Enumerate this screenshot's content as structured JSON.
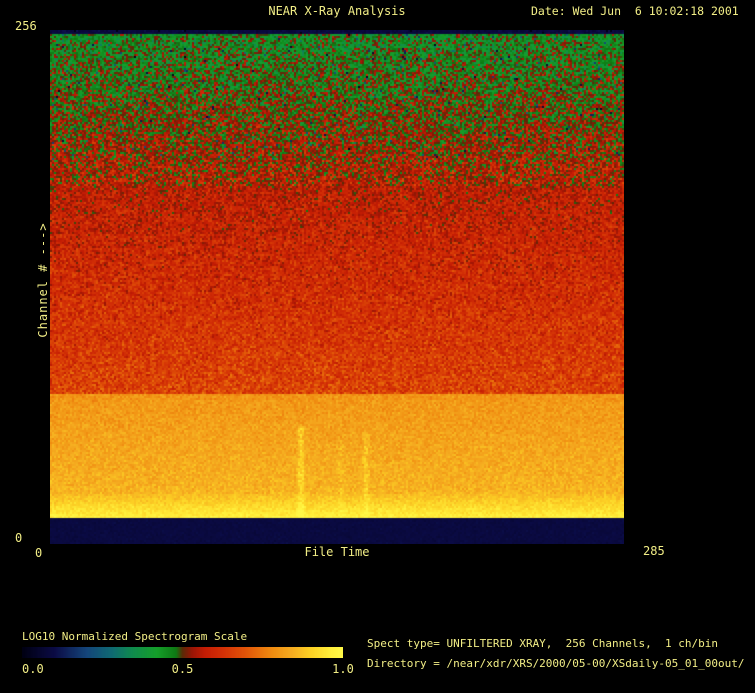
{
  "page": {
    "background": "#000000",
    "text_color": "#f2ee86"
  },
  "header": {
    "title": "NEAR X-Ray Analysis",
    "date": "Date: Wed Jun  6 10:02:18 2001"
  },
  "plot": {
    "y_max_label": "256",
    "y_min_label": "0",
    "y_axis_title": "Channel # --->",
    "x_min_label": "0",
    "x_max_label": "285",
    "x_axis_title": "File Time"
  },
  "colorbar": {
    "title": "LOG10 Normalized Spectrogram Scale",
    "tick_left": "0.0",
    "tick_mid": "0.5",
    "tick_right": "1.0"
  },
  "info": {
    "line1": "Spect type= UNFILTERED XRAY,  256 Channels,  1 ch/bin",
    "line2": "Directory = /near/xdr/XRS/2000/05-00/XSdaily-05_01_00out/"
  },
  "chart_data": {
    "type": "heatmap",
    "title": "NEAR X-Ray Analysis",
    "xlabel": "File Time",
    "ylabel": "Channel #",
    "x_range": [
      0,
      285
    ],
    "y_range": [
      0,
      256
    ],
    "channels": 256,
    "ch_per_bin": 1,
    "spect_type": "UNFILTERED XRAY",
    "scale": {
      "label": "LOG10 Normalized Spectrogram Scale",
      "ticks": [
        0.0,
        0.5,
        1.0
      ]
    },
    "legend_position": "bottom-left",
    "grid": false,
    "colormap_stops": [
      [
        0.0,
        "#000012"
      ],
      [
        0.1,
        "#0b0b45"
      ],
      [
        0.2,
        "#14457a"
      ],
      [
        0.28,
        "#0f6a72"
      ],
      [
        0.34,
        "#0f8a50"
      ],
      [
        0.42,
        "#15a02a"
      ],
      [
        0.48,
        "#0e7a14"
      ],
      [
        0.5,
        "#5a2a06"
      ],
      [
        0.53,
        "#9a1505"
      ],
      [
        0.57,
        "#c41c04"
      ],
      [
        0.63,
        "#d43206"
      ],
      [
        0.7,
        "#e25608"
      ],
      [
        0.78,
        "#f08c10"
      ],
      [
        0.84,
        "#f5ab20"
      ],
      [
        0.9,
        "#fcd024"
      ],
      [
        0.96,
        "#ffee3a"
      ],
      [
        1.0,
        "#fff948"
      ]
    ],
    "value_profile": [
      {
        "t0": 0.0,
        "t1": 0.007,
        "v0": 0.085,
        "v1": 0.085,
        "noise": 0.012
      },
      {
        "t0": 0.007,
        "t1": 0.3,
        "v0": 0.44,
        "v1": 0.56,
        "noise": 0.06
      },
      {
        "t0": 0.3,
        "t1": 0.708,
        "v0": 0.565,
        "v1": 0.665,
        "noise": 0.042
      },
      {
        "t0": 0.708,
        "t1": 0.9,
        "v0": 0.8,
        "v1": 0.855,
        "noise": 0.022
      },
      {
        "t0": 0.9,
        "t1": 0.947,
        "v0": 0.865,
        "v1": 0.968,
        "noise": 0.018
      },
      {
        "t0": 0.947,
        "t1": 1.001,
        "v0": 0.09,
        "v1": 0.09,
        "noise": 0.007
      }
    ],
    "dark_speck": {
      "t_max": 0.25,
      "prob": 0.02,
      "depth": 0.28
    },
    "streaks": [
      {
        "x": 250,
        "t0": 0.77,
        "t1": 0.947,
        "amp": 0.075,
        "sigma": 2.2
      },
      {
        "x": 290,
        "t0": 0.8,
        "t1": 0.947,
        "amp": 0.03,
        "sigma": 2.0
      },
      {
        "x": 315,
        "t0": 0.78,
        "t1": 0.947,
        "amp": 0.05,
        "sigma": 2.0
      }
    ],
    "cell": 2,
    "seed": 1234
  }
}
